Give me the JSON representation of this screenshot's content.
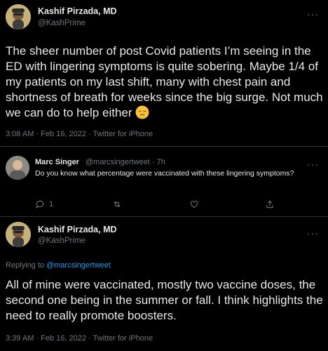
{
  "tweet1": {
    "name": "Kashif Pirzada, MD",
    "handle": "@KashPrime",
    "text": "The sheer number of post Covid patients I’m seeing in the ED with lingering symptoms is quite sobering. Maybe 1/4 of my patients on my last shift, many with chest pain and shortness of breath for weeks since the big surge. Not much we can do to help either",
    "emoji": "pensive-face-emoji",
    "meta": "3:08 AM · Feb 16, 2022 · Twitter for iPhone",
    "more": "···"
  },
  "reply": {
    "name": "Marc Singer",
    "handle": "@marcsingertweet · 7h",
    "text": "Do you know what percentage were vaccinated with these lingering symptoms?",
    "reply_count": "1",
    "more": "···"
  },
  "tweet2": {
    "name": "Kashif Pirzada, MD",
    "handle": "@KashPrime",
    "replying_prefix": "Replying to ",
    "replying_to": "@marcsingertweet",
    "text": "All of mine were vaccinated, mostly two vaccine doses, the second one being in the summer or fall.   I think highlights the need to really promote boosters.",
    "meta": "3:39 AM · Feb 16, 2022 · Twitter for iPhone",
    "more": "···"
  },
  "colors": {
    "background": "#000000",
    "text": "#e7e9ea",
    "secondary": "#71767b",
    "link": "#1d9bf0",
    "divider": "#2f3336"
  }
}
